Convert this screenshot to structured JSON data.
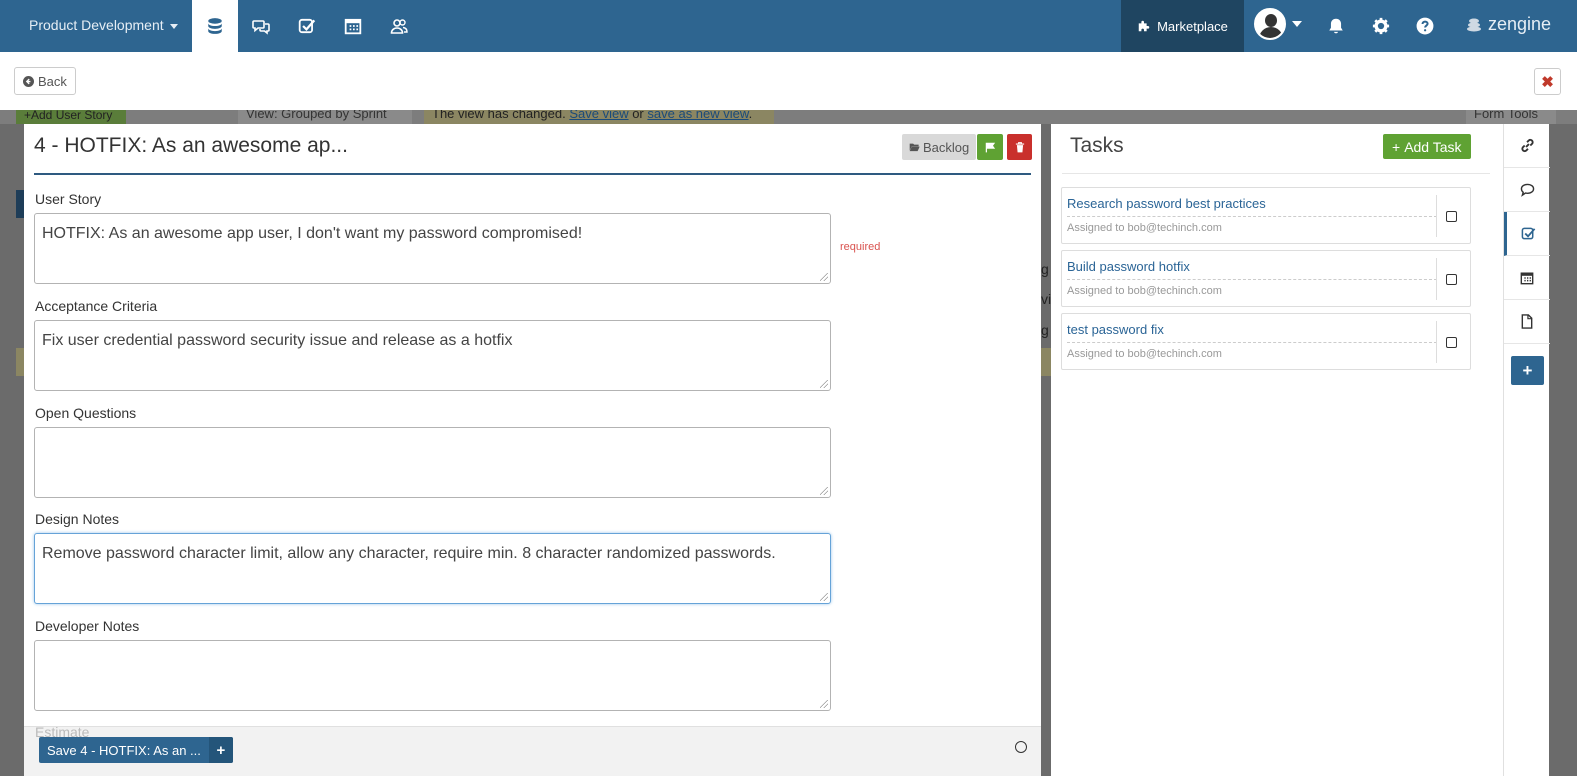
{
  "topnav": {
    "workspace": "Product Development",
    "marketplace": "Marketplace",
    "brand": "zengine"
  },
  "subbar": {
    "back": "Back"
  },
  "background": {
    "add_button": "+Add User Story",
    "view_label": "View: Grouped by Sprint",
    "changed_prefix": "The view has changed.",
    "save_view": "Save view",
    "or": "or",
    "save_as_new": "save as new view",
    "form_tools": "Form Tools",
    "right_fragments": [
      "g",
      "vi",
      "g"
    ]
  },
  "record": {
    "title": "4 - HOTFIX: As an awesome ap...",
    "backlog": "Backlog",
    "required": "required",
    "fields": [
      {
        "label": "User Story",
        "value": "HOTFIX: As an awesome app user, I don't want my password compromised!"
      },
      {
        "label": "Acceptance Criteria",
        "value": "Fix user credential password security issue and release as a hotfix"
      },
      {
        "label": "Open Questions",
        "value": ""
      },
      {
        "label": "Design Notes",
        "value": "Remove password character limit, allow any character, require min. 8 character randomized passwords."
      },
      {
        "label": "Developer Notes",
        "value": ""
      }
    ],
    "estimate_label": "Estimate",
    "save_label": "Save 4 - HOTFIX: As an ..."
  },
  "tasks": {
    "title": "Tasks",
    "add_label": "Add Task",
    "items": [
      {
        "name": "Research password best practices",
        "assigned": "Assigned to bob@techinch.com"
      },
      {
        "name": "Build password hotfix",
        "assigned": "Assigned to bob@techinch.com"
      },
      {
        "name": "test password fix",
        "assigned": "Assigned to bob@techinch.com"
      }
    ]
  },
  "colors": {
    "nav": "#2e6590",
    "marketplace": "#1f4561",
    "green": "#5fa233",
    "red": "#c9302c",
    "link": "#2a6496"
  }
}
